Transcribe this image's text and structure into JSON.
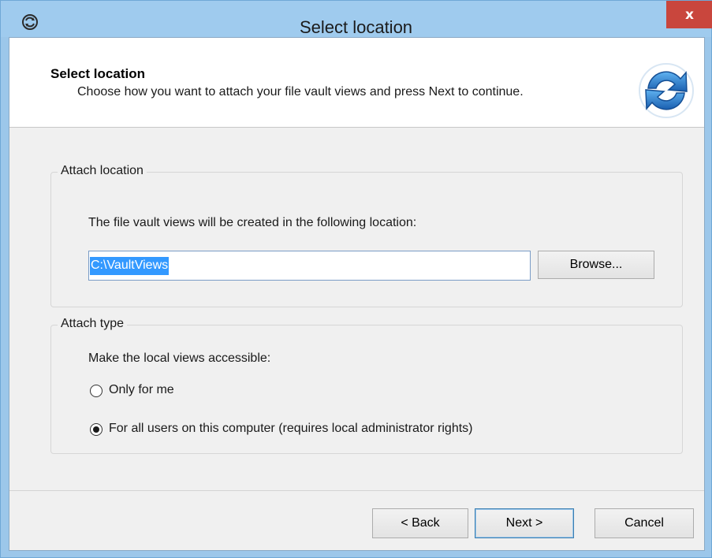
{
  "window": {
    "title": "Select location",
    "close_label": "x"
  },
  "header": {
    "title": "Select location",
    "subtitle": "Choose how you want to attach your file vault views and press Next to continue."
  },
  "attach_location": {
    "legend": "Attach location",
    "description": "The file vault views will be created in the following location:",
    "path_value": "C:\\VaultViews",
    "browse_label": "Browse..."
  },
  "attach_type": {
    "legend": "Attach type",
    "description": "Make the local views accessible:",
    "options": [
      {
        "label": "Only for me",
        "selected": false
      },
      {
        "label": "For all users on this computer (requires local administrator rights)",
        "selected": true
      }
    ]
  },
  "buttons": {
    "back_label": "< Back",
    "next_label": "Next >",
    "cancel_label": "Cancel"
  },
  "colors": {
    "titlebar": "#9fcbee",
    "close": "#c9463d",
    "selection": "#3399ff",
    "icon_blue": "#2a7fd4"
  },
  "icons": {
    "app": "refresh-arrows-icon",
    "header": "sync-arrows-icon"
  }
}
